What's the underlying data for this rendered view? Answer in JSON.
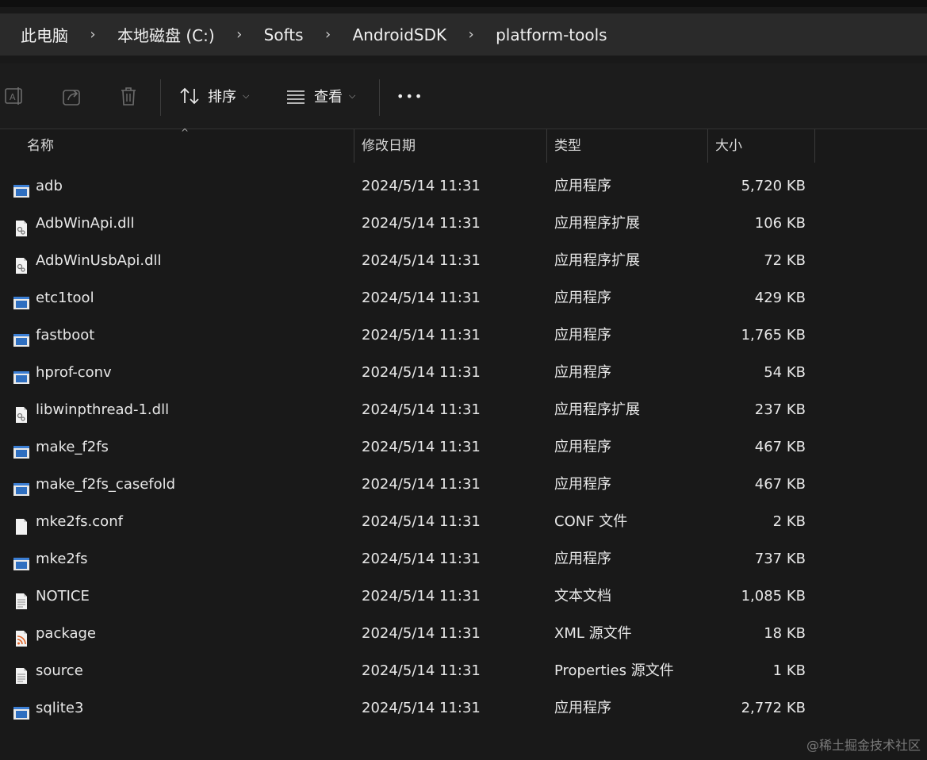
{
  "breadcrumb": [
    "此电脑",
    "本地磁盘 (C:)",
    "Softs",
    "AndroidSDK",
    "platform-tools"
  ],
  "breadcrumb_separator": "›",
  "toolbar": {
    "rename_icon": "rename-icon",
    "share_icon": "share-icon",
    "delete_icon": "trash-icon",
    "sort_label": "排序",
    "view_label": "查看",
    "more_label": "•••"
  },
  "columns": {
    "name": "名称",
    "date": "修改日期",
    "type": "类型",
    "size": "大小"
  },
  "files": [
    {
      "name": "adb",
      "date": "2024/5/14 11:31",
      "type": "应用程序",
      "size": "5,720 KB",
      "icon": "exe-icon"
    },
    {
      "name": "AdbWinApi.dll",
      "date": "2024/5/14 11:31",
      "type": "应用程序扩展",
      "size": "106 KB",
      "icon": "dll-icon"
    },
    {
      "name": "AdbWinUsbApi.dll",
      "date": "2024/5/14 11:31",
      "type": "应用程序扩展",
      "size": "72 KB",
      "icon": "dll-icon"
    },
    {
      "name": "etc1tool",
      "date": "2024/5/14 11:31",
      "type": "应用程序",
      "size": "429 KB",
      "icon": "exe-icon"
    },
    {
      "name": "fastboot",
      "date": "2024/5/14 11:31",
      "type": "应用程序",
      "size": "1,765 KB",
      "icon": "exe-icon"
    },
    {
      "name": "hprof-conv",
      "date": "2024/5/14 11:31",
      "type": "应用程序",
      "size": "54 KB",
      "icon": "exe-icon"
    },
    {
      "name": "libwinpthread-1.dll",
      "date": "2024/5/14 11:31",
      "type": "应用程序扩展",
      "size": "237 KB",
      "icon": "dll-icon"
    },
    {
      "name": "make_f2fs",
      "date": "2024/5/14 11:31",
      "type": "应用程序",
      "size": "467 KB",
      "icon": "exe-icon"
    },
    {
      "name": "make_f2fs_casefold",
      "date": "2024/5/14 11:31",
      "type": "应用程序",
      "size": "467 KB",
      "icon": "exe-icon"
    },
    {
      "name": "mke2fs.conf",
      "date": "2024/5/14 11:31",
      "type": "CONF 文件",
      "size": "2 KB",
      "icon": "file-icon"
    },
    {
      "name": "mke2fs",
      "date": "2024/5/14 11:31",
      "type": "应用程序",
      "size": "737 KB",
      "icon": "exe-icon"
    },
    {
      "name": "NOTICE",
      "date": "2024/5/14 11:31",
      "type": "文本文档",
      "size": "1,085 KB",
      "icon": "text-file-icon"
    },
    {
      "name": "package",
      "date": "2024/5/14 11:31",
      "type": "XML 源文件",
      "size": "18 KB",
      "icon": "xml-feed-icon"
    },
    {
      "name": "source",
      "date": "2024/5/14 11:31",
      "type": "Properties 源文件",
      "size": "1 KB",
      "icon": "text-file-icon"
    },
    {
      "name": "sqlite3",
      "date": "2024/5/14 11:31",
      "type": "应用程序",
      "size": "2,772 KB",
      "icon": "exe-icon"
    }
  ],
  "watermark": "@稀土掘金技术社区"
}
